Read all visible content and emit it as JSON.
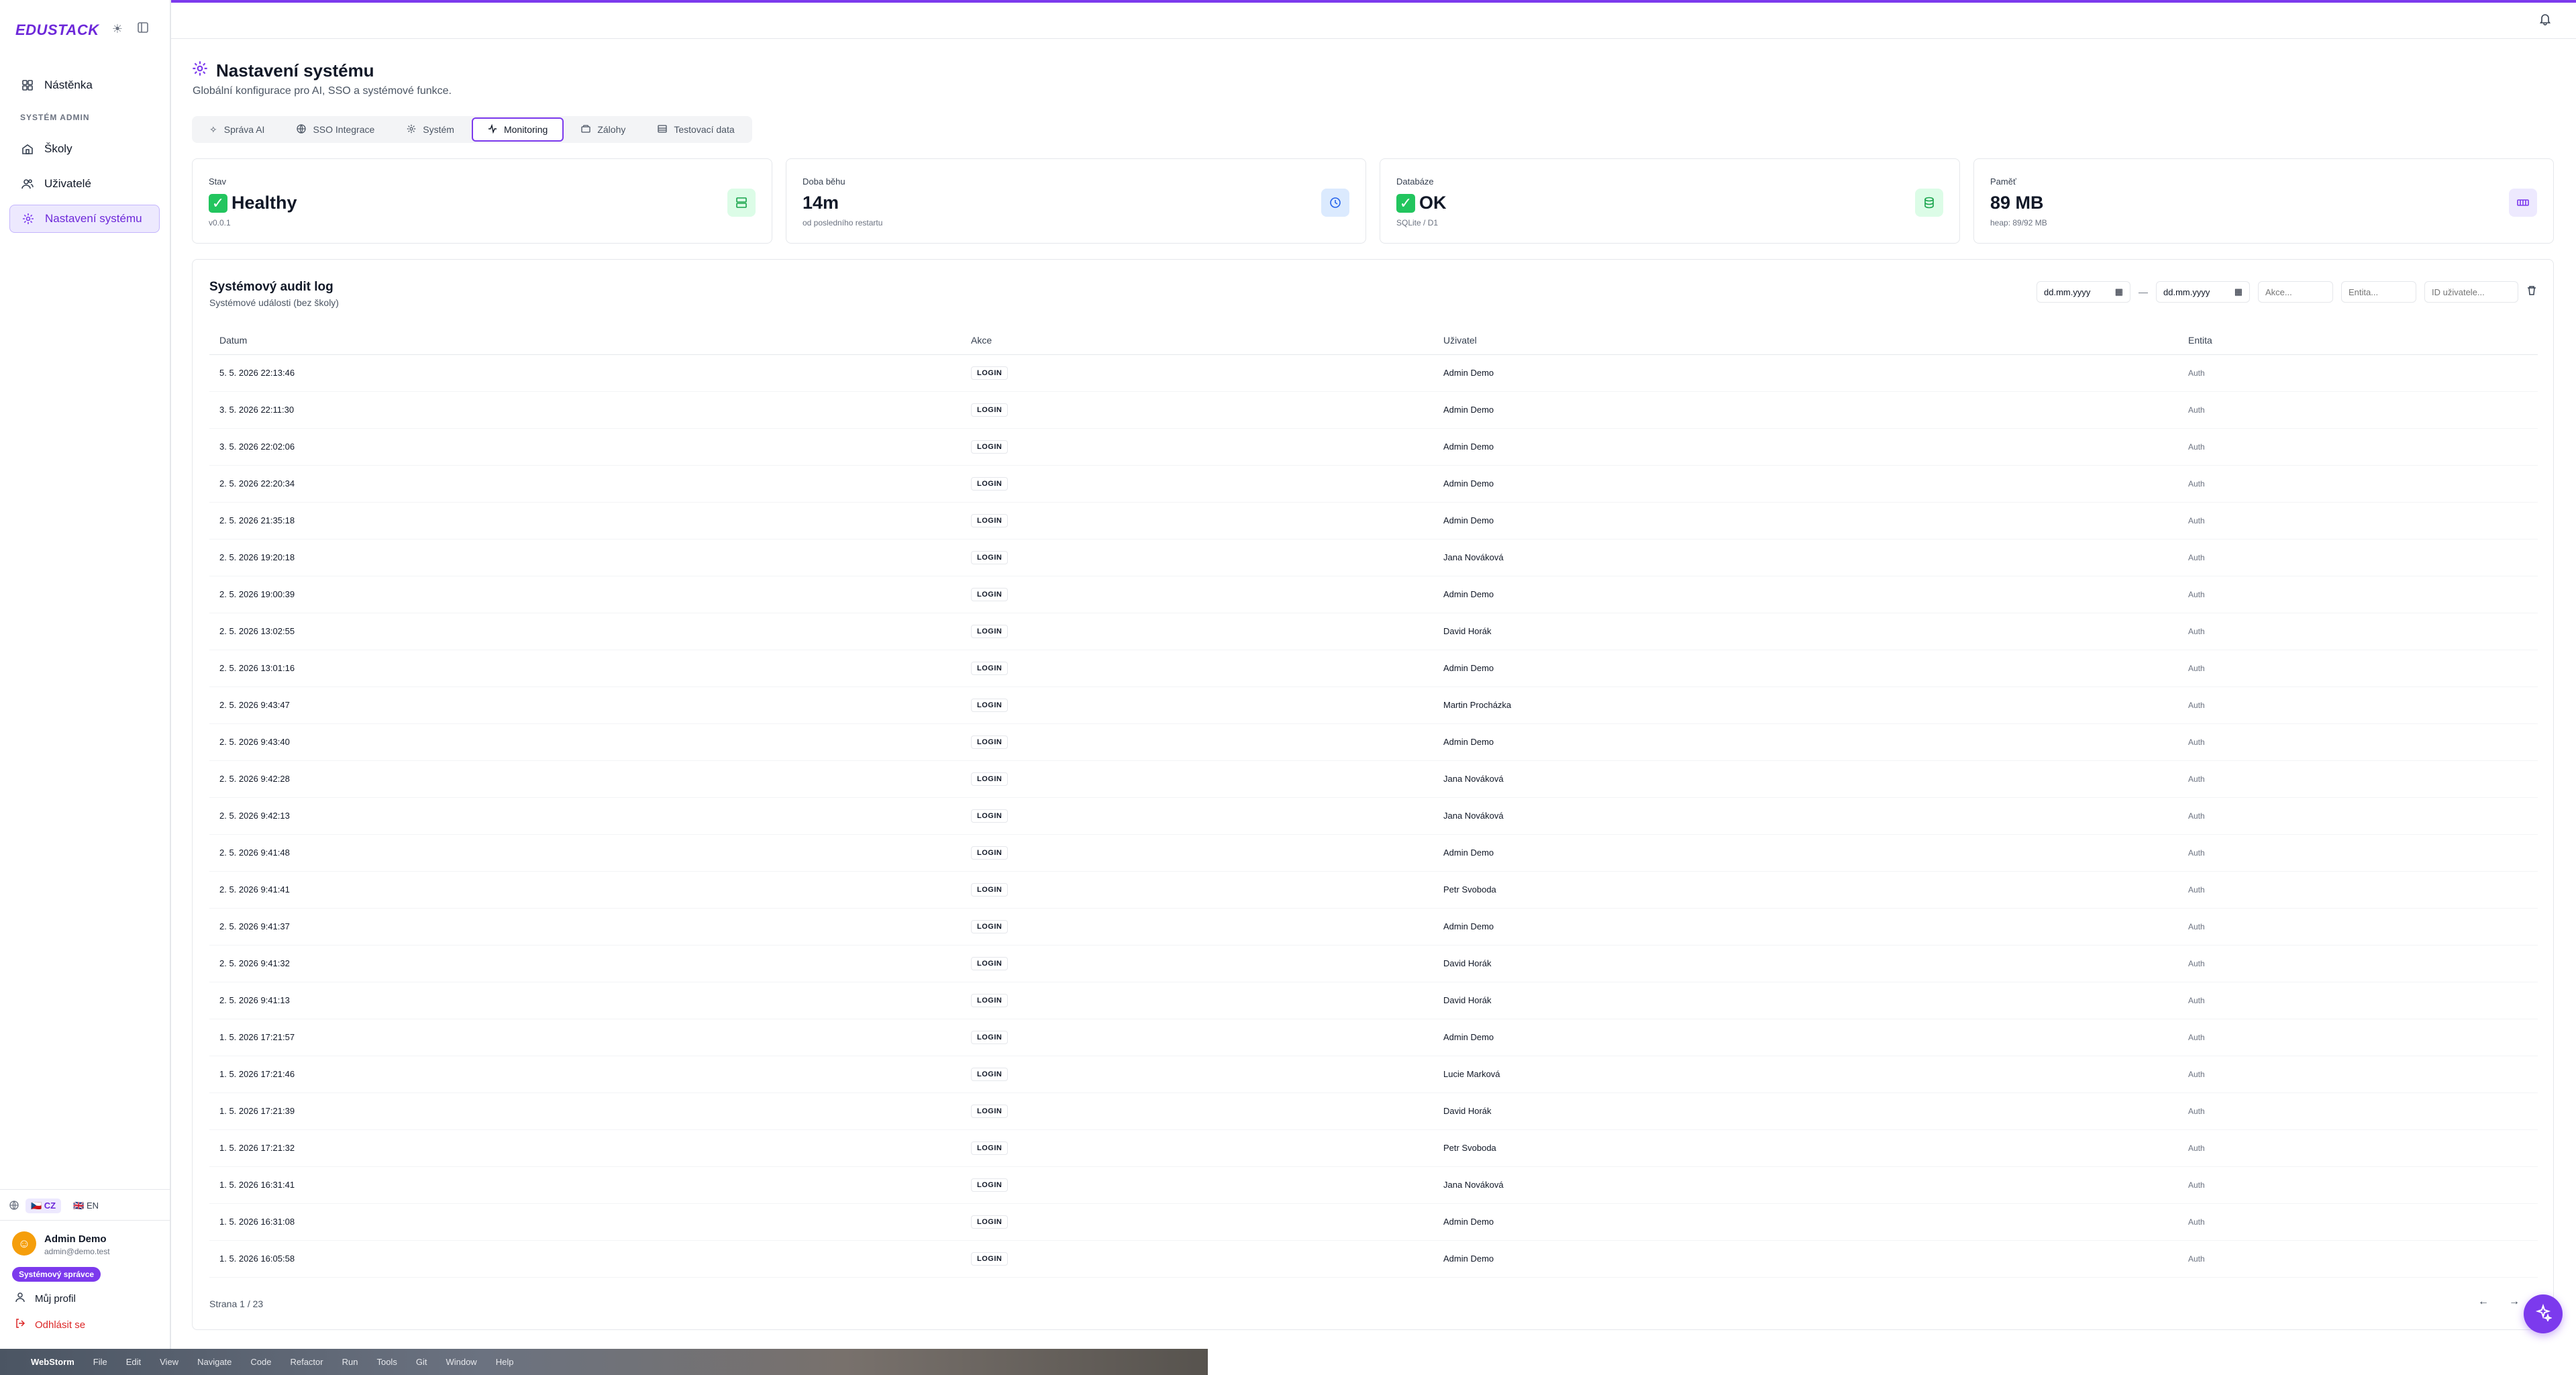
{
  "app": {
    "brand": "EDUSTACK"
  },
  "sidebar": {
    "section_label": "SYSTÉM ADMIN",
    "items": [
      {
        "label": "Nástěnka",
        "icon": "dashboard-icon"
      },
      {
        "label": "Školy",
        "icon": "school-icon"
      },
      {
        "label": "Uživatelé",
        "icon": "users-icon"
      },
      {
        "label": "Nastavení systému",
        "icon": "gear-icon",
        "active": true
      }
    ],
    "languages": [
      {
        "label": "🇨🇿 CZ",
        "active": true
      },
      {
        "label": "🇬🇧 EN",
        "active": false
      }
    ],
    "user": {
      "name": "Admin Demo",
      "email": "admin@demo.test",
      "role": "Systémový správce"
    },
    "profile_label": "Můj profil",
    "logout_label": "Odhlásit se"
  },
  "header": {
    "title": "Nastavení systému",
    "subtitle": "Globální konfigurace pro AI, SSO a systémové funkce."
  },
  "tabs": [
    {
      "label": "Správa AI",
      "icon": "sparkle-icon"
    },
    {
      "label": "SSO Integrace",
      "icon": "globe-icon"
    },
    {
      "label": "Systém",
      "icon": "gear-icon"
    },
    {
      "label": "Monitoring",
      "icon": "activity-icon",
      "active": true
    },
    {
      "label": "Zálohy",
      "icon": "backup-icon"
    },
    {
      "label": "Testovací data",
      "icon": "database-icon"
    }
  ],
  "stats": [
    {
      "label": "Stav",
      "value": "Healthy",
      "check": true,
      "sub": "v0.0.1",
      "icon": "server-icon",
      "color": "#16a34a",
      "bg": "#dcfce7"
    },
    {
      "label": "Doba běhu",
      "value": "14m",
      "check": false,
      "sub": "od posledního restartu",
      "icon": "clock-icon",
      "color": "#2563eb",
      "bg": "#dbeafe"
    },
    {
      "label": "Databáze",
      "value": "OK",
      "check": true,
      "sub": "SQLite / D1",
      "icon": "database-icon",
      "color": "#16a34a",
      "bg": "#dcfce7"
    },
    {
      "label": "Paměť",
      "value": "89 MB",
      "check": false,
      "sub": "heap: 89/92 MB",
      "icon": "memory-icon",
      "color": "#7c3aed",
      "bg": "#ede9fe"
    }
  ],
  "audit": {
    "title": "Systémový audit log",
    "subtitle": "Systémové události (bez školy)",
    "filters": {
      "date_from": "dd.mm.yyyy",
      "date_to": "dd.mm.yyyy",
      "action_placeholder": "Akce...",
      "entity_placeholder": "Entita...",
      "user_placeholder": "ID uživatele..."
    },
    "columns": [
      "Datum",
      "Akce",
      "Uživatel",
      "Entita"
    ],
    "rows": [
      {
        "date": "5. 5. 2026 22:13:46",
        "action": "LOGIN",
        "user": "Admin Demo",
        "entity": "Auth"
      },
      {
        "date": "3. 5. 2026 22:11:30",
        "action": "LOGIN",
        "user": "Admin Demo",
        "entity": "Auth"
      },
      {
        "date": "3. 5. 2026 22:02:06",
        "action": "LOGIN",
        "user": "Admin Demo",
        "entity": "Auth"
      },
      {
        "date": "2. 5. 2026 22:20:34",
        "action": "LOGIN",
        "user": "Admin Demo",
        "entity": "Auth"
      },
      {
        "date": "2. 5. 2026 21:35:18",
        "action": "LOGIN",
        "user": "Admin Demo",
        "entity": "Auth"
      },
      {
        "date": "2. 5. 2026 19:20:18",
        "action": "LOGIN",
        "user": "Jana Nováková",
        "entity": "Auth"
      },
      {
        "date": "2. 5. 2026 19:00:39",
        "action": "LOGIN",
        "user": "Admin Demo",
        "entity": "Auth"
      },
      {
        "date": "2. 5. 2026 13:02:55",
        "action": "LOGIN",
        "user": "David Horák",
        "entity": "Auth"
      },
      {
        "date": "2. 5. 2026 13:01:16",
        "action": "LOGIN",
        "user": "Admin Demo",
        "entity": "Auth"
      },
      {
        "date": "2. 5. 2026 9:43:47",
        "action": "LOGIN",
        "user": "Martin Procházka",
        "entity": "Auth"
      },
      {
        "date": "2. 5. 2026 9:43:40",
        "action": "LOGIN",
        "user": "Admin Demo",
        "entity": "Auth"
      },
      {
        "date": "2. 5. 2026 9:42:28",
        "action": "LOGIN",
        "user": "Jana Nováková",
        "entity": "Auth"
      },
      {
        "date": "2. 5. 2026 9:42:13",
        "action": "LOGIN",
        "user": "Jana Nováková",
        "entity": "Auth"
      },
      {
        "date": "2. 5. 2026 9:41:48",
        "action": "LOGIN",
        "user": "Admin Demo",
        "entity": "Auth"
      },
      {
        "date": "2. 5. 2026 9:41:41",
        "action": "LOGIN",
        "user": "Petr Svoboda",
        "entity": "Auth"
      },
      {
        "date": "2. 5. 2026 9:41:37",
        "action": "LOGIN",
        "user": "Admin Demo",
        "entity": "Auth"
      },
      {
        "date": "2. 5. 2026 9:41:32",
        "action": "LOGIN",
        "user": "David Horák",
        "entity": "Auth"
      },
      {
        "date": "2. 5. 2026 9:41:13",
        "action": "LOGIN",
        "user": "David Horák",
        "entity": "Auth"
      },
      {
        "date": "1. 5. 2026 17:21:57",
        "action": "LOGIN",
        "user": "Admin Demo",
        "entity": "Auth"
      },
      {
        "date": "1. 5. 2026 17:21:46",
        "action": "LOGIN",
        "user": "Lucie Marková",
        "entity": "Auth"
      },
      {
        "date": "1. 5. 2026 17:21:39",
        "action": "LOGIN",
        "user": "David Horák",
        "entity": "Auth"
      },
      {
        "date": "1. 5. 2026 17:21:32",
        "action": "LOGIN",
        "user": "Petr Svoboda",
        "entity": "Auth"
      },
      {
        "date": "1. 5. 2026 16:31:41",
        "action": "LOGIN",
        "user": "Jana Nováková",
        "entity": "Auth"
      },
      {
        "date": "1. 5. 2026 16:31:08",
        "action": "LOGIN",
        "user": "Admin Demo",
        "entity": "Auth"
      },
      {
        "date": "1. 5. 2026 16:05:58",
        "action": "LOGIN",
        "user": "Admin Demo",
        "entity": "Auth"
      }
    ],
    "pager": "Strana 1 / 23"
  },
  "taskbar": {
    "items": [
      "WebStorm",
      "File",
      "Edit",
      "View",
      "Navigate",
      "Code",
      "Refactor",
      "Run",
      "Tools",
      "Git",
      "Window",
      "Help"
    ]
  }
}
